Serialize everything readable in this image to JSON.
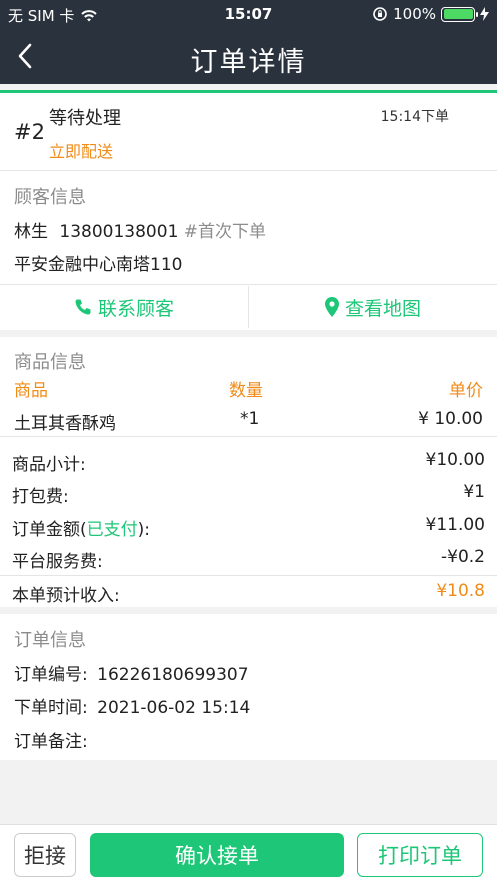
{
  "status_bar": {
    "carrier": "无 SIM 卡",
    "time": "15:07",
    "battery": "100%",
    "battery_level": 1.0
  },
  "nav": {
    "title": "订单详情",
    "back_icon": "chevron-left-icon"
  },
  "order": {
    "number": "#2",
    "status": "等待处理",
    "delivery": "立即配送",
    "time": "15:14下单"
  },
  "customer": {
    "section_title": "顾客信息",
    "name": "林生",
    "phone": "13800138001",
    "tag": "#首次下单",
    "address": "平安金融中心南塔110",
    "contact_label": "联系顾客",
    "map_label": "查看地图"
  },
  "goods": {
    "section_title": "商品信息",
    "headers": {
      "name": "商品",
      "qty": "数量",
      "price": "单价"
    },
    "items": [
      {
        "name": "土耳其香酥鸡",
        "qty": "*1",
        "price": "¥ 10.00"
      }
    ]
  },
  "summary": {
    "subtotal_label": "商品小计:",
    "subtotal_value": "¥10.00",
    "packing_label": "打包费:",
    "packing_value": "¥1",
    "amount_label_prefix": "订单金额(",
    "amount_paid": "已支付",
    "amount_label_suffix": "):",
    "amount_value": "¥11.00",
    "service_label": "平台服务费:",
    "service_value": "-¥0.2",
    "income_label": "本单预计收入:",
    "income_value": "¥10.8"
  },
  "order_info": {
    "section_title": "订单信息",
    "number_label": "订单编号:",
    "number_value": "16226180699307",
    "time_label": "下单时间:",
    "time_value": "2021-06-02 15:14",
    "note_label": "订单备注:"
  },
  "actions": {
    "reject": "拒接",
    "confirm": "确认接单",
    "print": "打印订单"
  },
  "colors": {
    "nav_bg": "#2a323d",
    "accent": "#1ec777",
    "orange": "#f08c1a"
  }
}
